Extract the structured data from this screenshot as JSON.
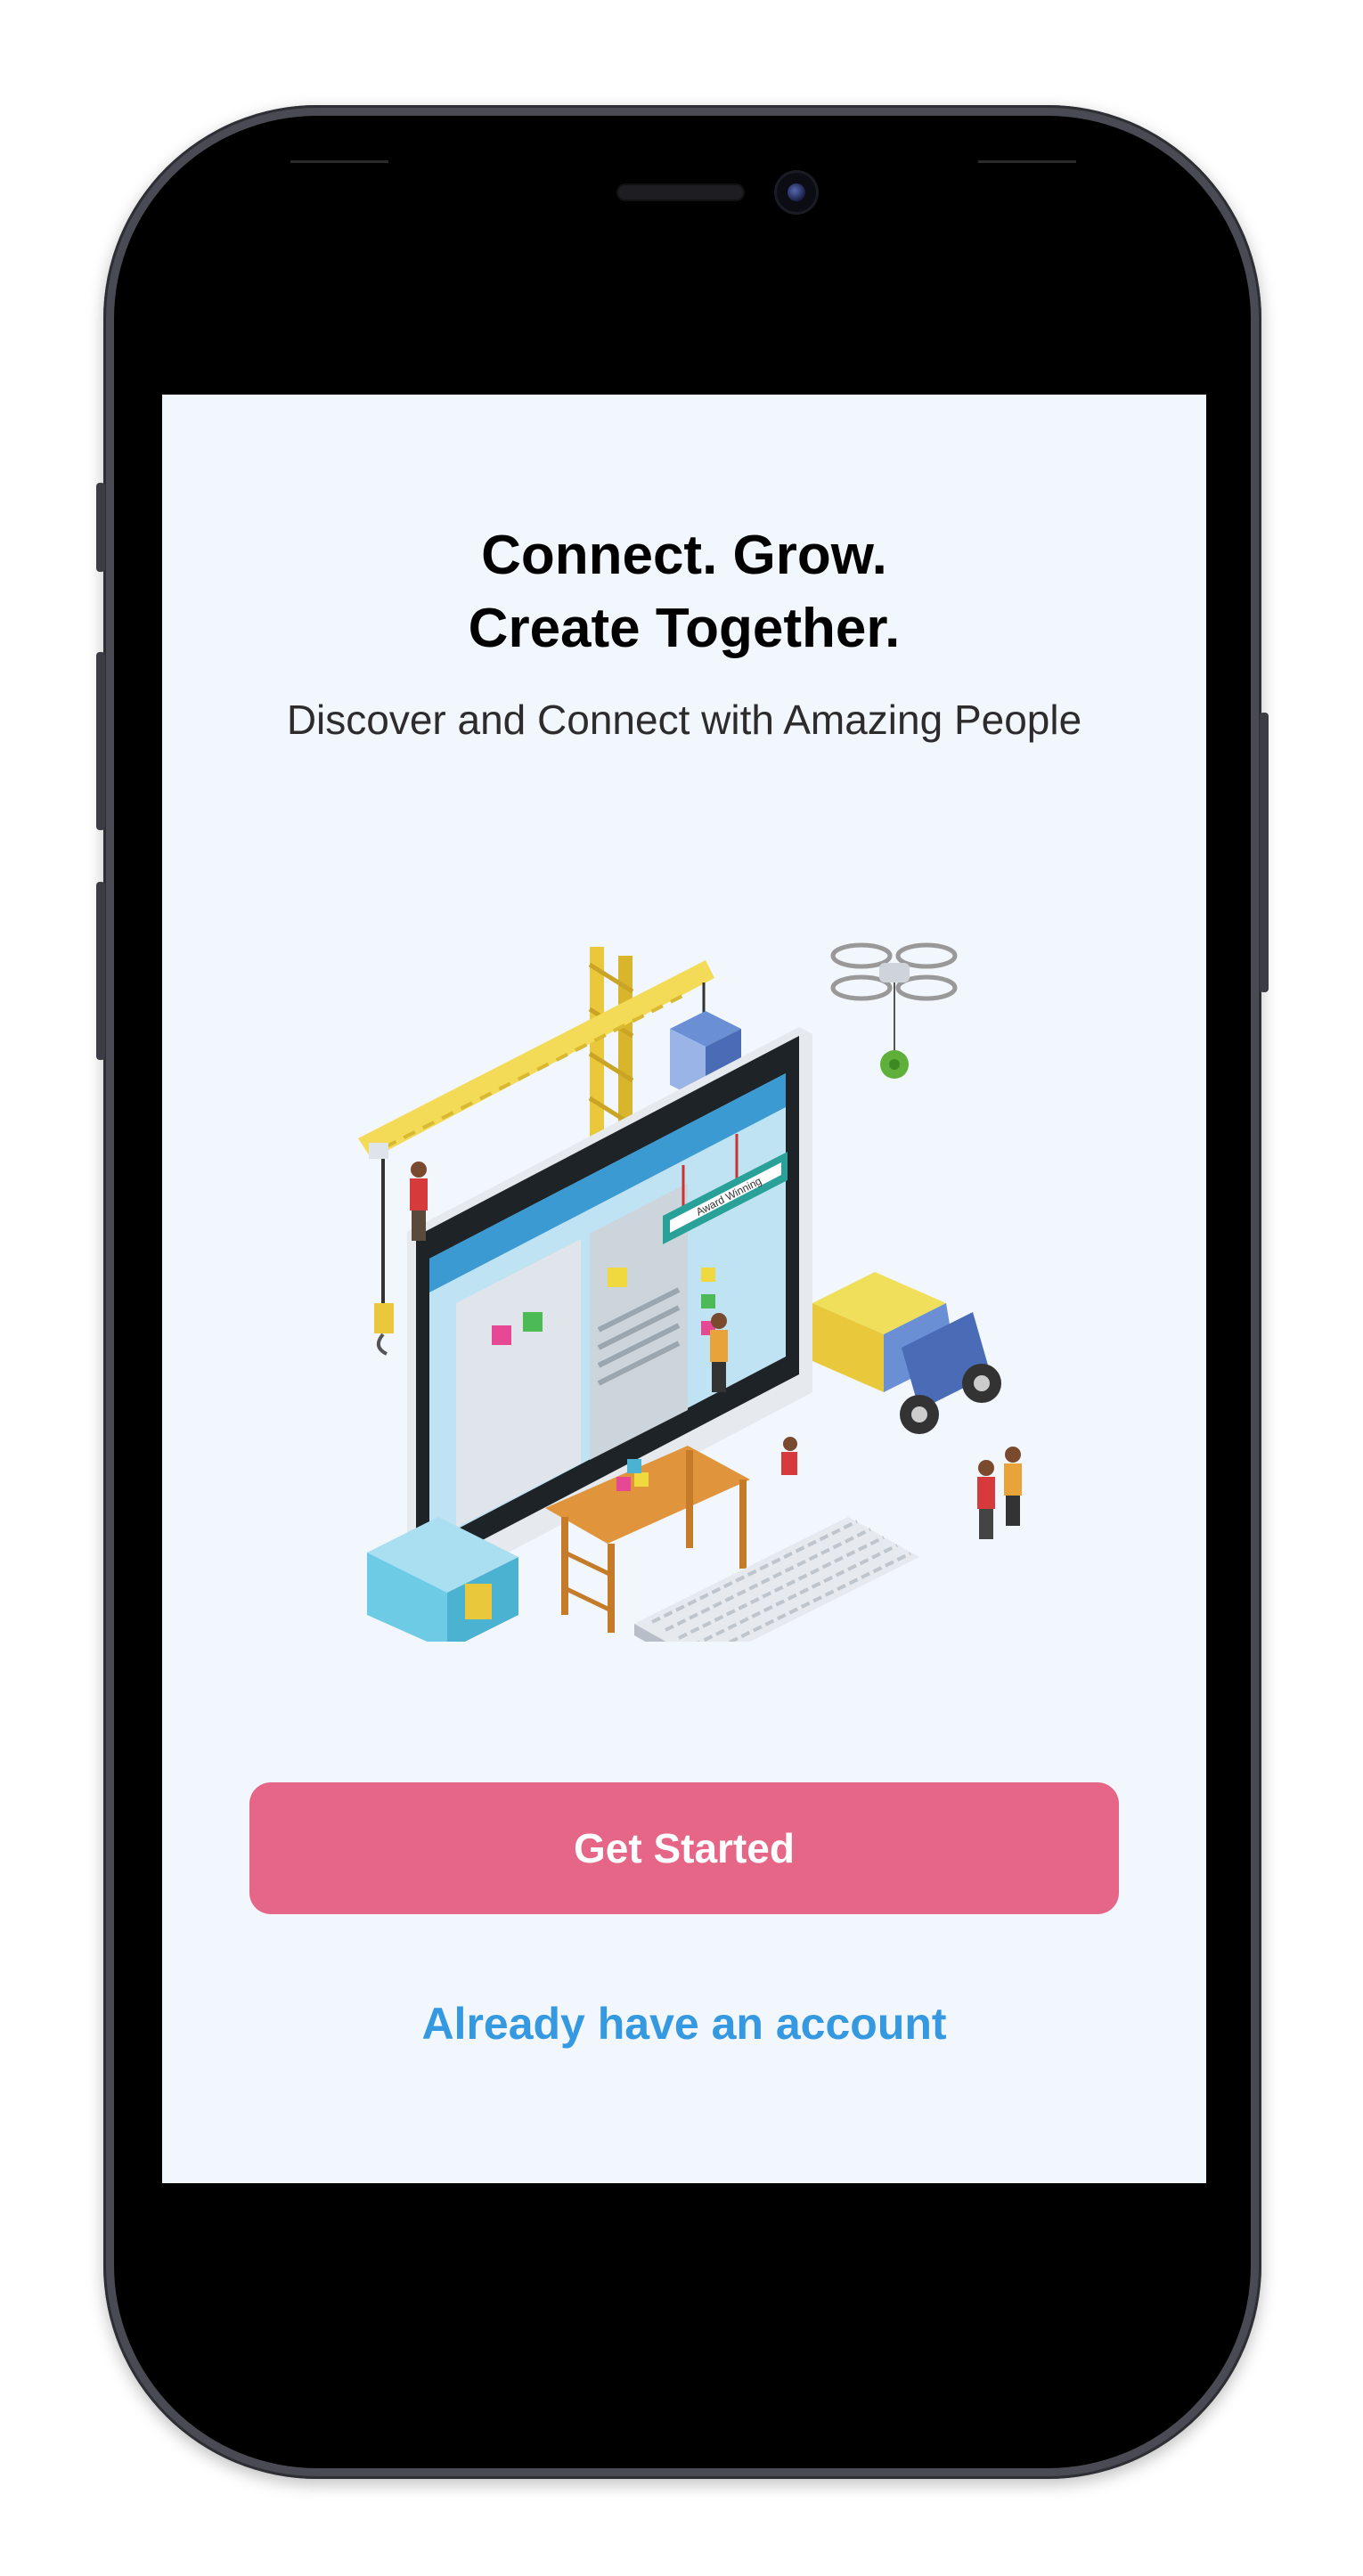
{
  "screen": {
    "background": "#f2f6fd",
    "headline_line1": "Connect. Grow.",
    "headline_line2": "Create Together.",
    "subtitle": "Discover and Connect with Amazing People",
    "illustration_icon": "isometric-website-construction-illustration",
    "illustration_badge": "Award Winning",
    "primary_button": {
      "label": "Get Started",
      "color": "#e56687"
    },
    "secondary_link": {
      "label": "Already have an account",
      "color": "#3499e0"
    }
  }
}
